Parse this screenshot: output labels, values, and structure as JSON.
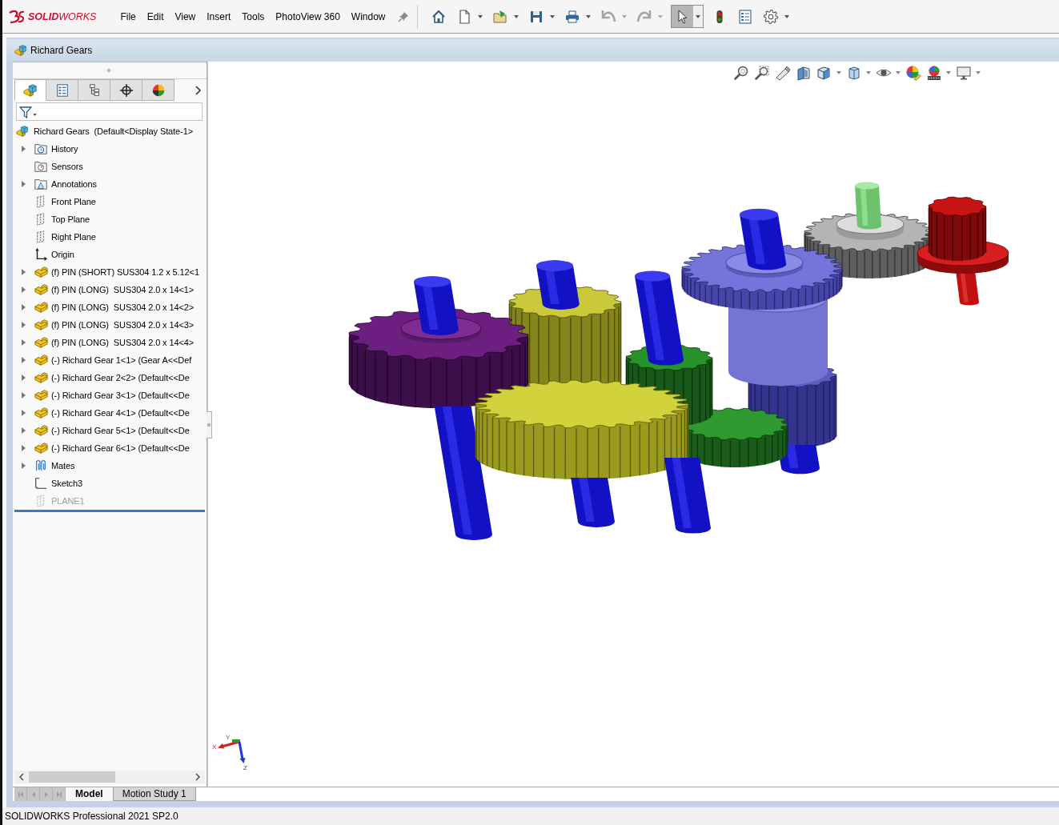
{
  "app": {
    "logo": "**SOLID**WORKS"
  },
  "menu": [
    "File",
    "Edit",
    "View",
    "Insert",
    "Tools",
    "PhotoView 360",
    "Window"
  ],
  "toolbar": [
    {
      "has_menu": false,
      "disabled": false,
      "selected": false
    },
    {
      "has_menu": true,
      "disabled": false,
      "selected": false
    },
    {
      "has_menu": true,
      "disabled": false,
      "selected": false
    },
    {
      "has_menu": true,
      "disabled": false,
      "selected": false
    },
    {
      "has_menu": true,
      "disabled": false,
      "selected": false
    },
    {
      "has_menu": true,
      "disabled": true,
      "selected": false
    },
    {
      "has_menu": true,
      "disabled": true,
      "selected": false
    },
    {
      "has_menu": true,
      "disabled": false,
      "selected": true
    },
    {
      "has_menu": false,
      "disabled": false,
      "selected": false
    },
    {
      "has_menu": false,
      "disabled": false,
      "selected": false
    },
    {
      "has_menu": true,
      "disabled": false,
      "selected": false
    }
  ],
  "document": {
    "title": "Richard Gears"
  },
  "feature_manager": {
    "tabs": [
      {
        "selected": true
      },
      {
        "selected": false
      },
      {
        "selected": false
      },
      {
        "selected": false
      },
      {
        "selected": false
      }
    ],
    "tree": {
      "root": "Richard Gears  (Default<Display State-1>",
      "items": [
        {
          "label": "History",
          "kind": "history",
          "expandable": true,
          "suppressed": false
        },
        {
          "label": "Sensors",
          "kind": "sensors",
          "expandable": false,
          "suppressed": false
        },
        {
          "label": "Annotations",
          "kind": "annotations",
          "expandable": true,
          "suppressed": false
        },
        {
          "label": "Front Plane",
          "kind": "plane",
          "expandable": false,
          "suppressed": false
        },
        {
          "label": "Top Plane",
          "kind": "plane",
          "expandable": false,
          "suppressed": false
        },
        {
          "label": "Right Plane",
          "kind": "plane",
          "expandable": false,
          "suppressed": false
        },
        {
          "label": "Origin",
          "kind": "origin",
          "expandable": false,
          "suppressed": false
        },
        {
          "label": "(f) PIN (SHORT) SUS304 1.2 x 5.12<1",
          "kind": "part",
          "expandable": true,
          "suppressed": false
        },
        {
          "label": "(f) PIN (LONG)  SUS304 2.0 x 14<1>",
          "kind": "part",
          "expandable": true,
          "suppressed": false
        },
        {
          "label": "(f) PIN (LONG)  SUS304 2.0 x 14<2>",
          "kind": "part",
          "expandable": true,
          "suppressed": false
        },
        {
          "label": "(f) PIN (LONG)  SUS304 2.0 x 14<3>",
          "kind": "part",
          "expandable": true,
          "suppressed": false
        },
        {
          "label": "(f) PIN (LONG)  SUS304 2.0 x 14<4>",
          "kind": "part",
          "expandable": true,
          "suppressed": false
        },
        {
          "label": "(-) Richard Gear 1<1> (Gear A<<Def",
          "kind": "part",
          "expandable": true,
          "suppressed": false
        },
        {
          "label": "(-) Richard Gear 2<2> (Default<<De",
          "kind": "part",
          "expandable": true,
          "suppressed": false
        },
        {
          "label": "(-) Richard Gear 3<1> (Default<<De",
          "kind": "part",
          "expandable": true,
          "suppressed": false
        },
        {
          "label": "(-) Richard Gear 4<1> (Default<<De",
          "kind": "part",
          "expandable": true,
          "suppressed": false
        },
        {
          "label": "(-) Richard Gear 5<1> (Default<<De",
          "kind": "part",
          "expandable": true,
          "suppressed": false
        },
        {
          "label": "(-) Richard Gear 6<1> (Default<<De",
          "kind": "part",
          "expandable": true,
          "suppressed": false
        },
        {
          "label": "Mates",
          "kind": "mates",
          "expandable": true,
          "suppressed": false
        },
        {
          "label": "Sketch3",
          "kind": "sketch",
          "expandable": false,
          "suppressed": false
        },
        {
          "label": "PLANE1",
          "kind": "plane",
          "expandable": false,
          "suppressed": true
        }
      ]
    }
  },
  "view_toolbar": [
    {
      "has_menu": false
    },
    {
      "has_menu": false
    },
    {
      "has_menu": false
    },
    {
      "has_menu": false
    },
    {
      "has_menu": true
    },
    {
      "has_menu": true
    },
    {
      "has_menu": true
    },
    {
      "has_menu": false
    },
    {
      "has_menu": true
    },
    {
      "has_menu": true
    }
  ],
  "triad": {
    "labels": [
      "X",
      "Y",
      "Z"
    ]
  },
  "bottom_tab_nav": [
    {
      "disabled": true
    },
    {
      "disabled": true
    },
    {
      "disabled": true
    },
    {
      "disabled": true
    }
  ],
  "bottom_tabs": [
    {
      "label": "Model",
      "selected": true
    },
    {
      "label": "Motion Study 1",
      "selected": false
    }
  ],
  "status_bar": {
    "text": "SOLIDWORKS Professional 2021 SP2.0"
  }
}
